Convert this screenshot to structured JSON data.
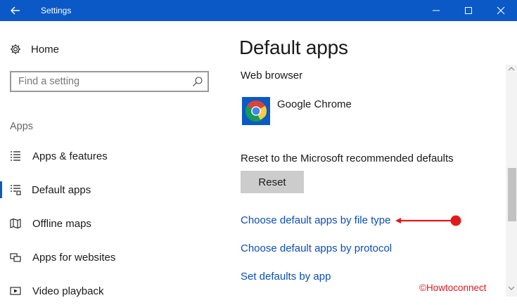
{
  "window": {
    "title": "Settings",
    "back_icon": "back-arrow-icon",
    "controls": [
      "minimize-icon",
      "maximize-icon",
      "close-icon"
    ]
  },
  "sidebar": {
    "home_label": "Home",
    "search_placeholder": "Find a setting",
    "section_title": "Apps",
    "items": [
      {
        "label": "Apps & features",
        "icon": "list-icon",
        "active": false
      },
      {
        "label": "Default apps",
        "icon": "default-apps-icon",
        "active": true
      },
      {
        "label": "Offline maps",
        "icon": "map-icon",
        "active": false
      },
      {
        "label": "Apps for websites",
        "icon": "link-icon",
        "active": false
      },
      {
        "label": "Video playback",
        "icon": "video-icon",
        "active": false
      }
    ]
  },
  "main": {
    "title": "Default apps",
    "web_browser": {
      "heading": "Web browser",
      "app_name": "Google Chrome",
      "app_icon": "chrome-icon"
    },
    "reset": {
      "label": "Reset to the Microsoft recommended defaults",
      "button": "Reset"
    },
    "links": [
      "Choose default apps by file type",
      "Choose default apps by protocol",
      "Set defaults by app"
    ]
  },
  "annotation": {
    "color": "#e0191e"
  },
  "watermark": "©Howtoconnect",
  "colors": {
    "accent": "#0a59c7",
    "link": "#0a4fb5"
  }
}
